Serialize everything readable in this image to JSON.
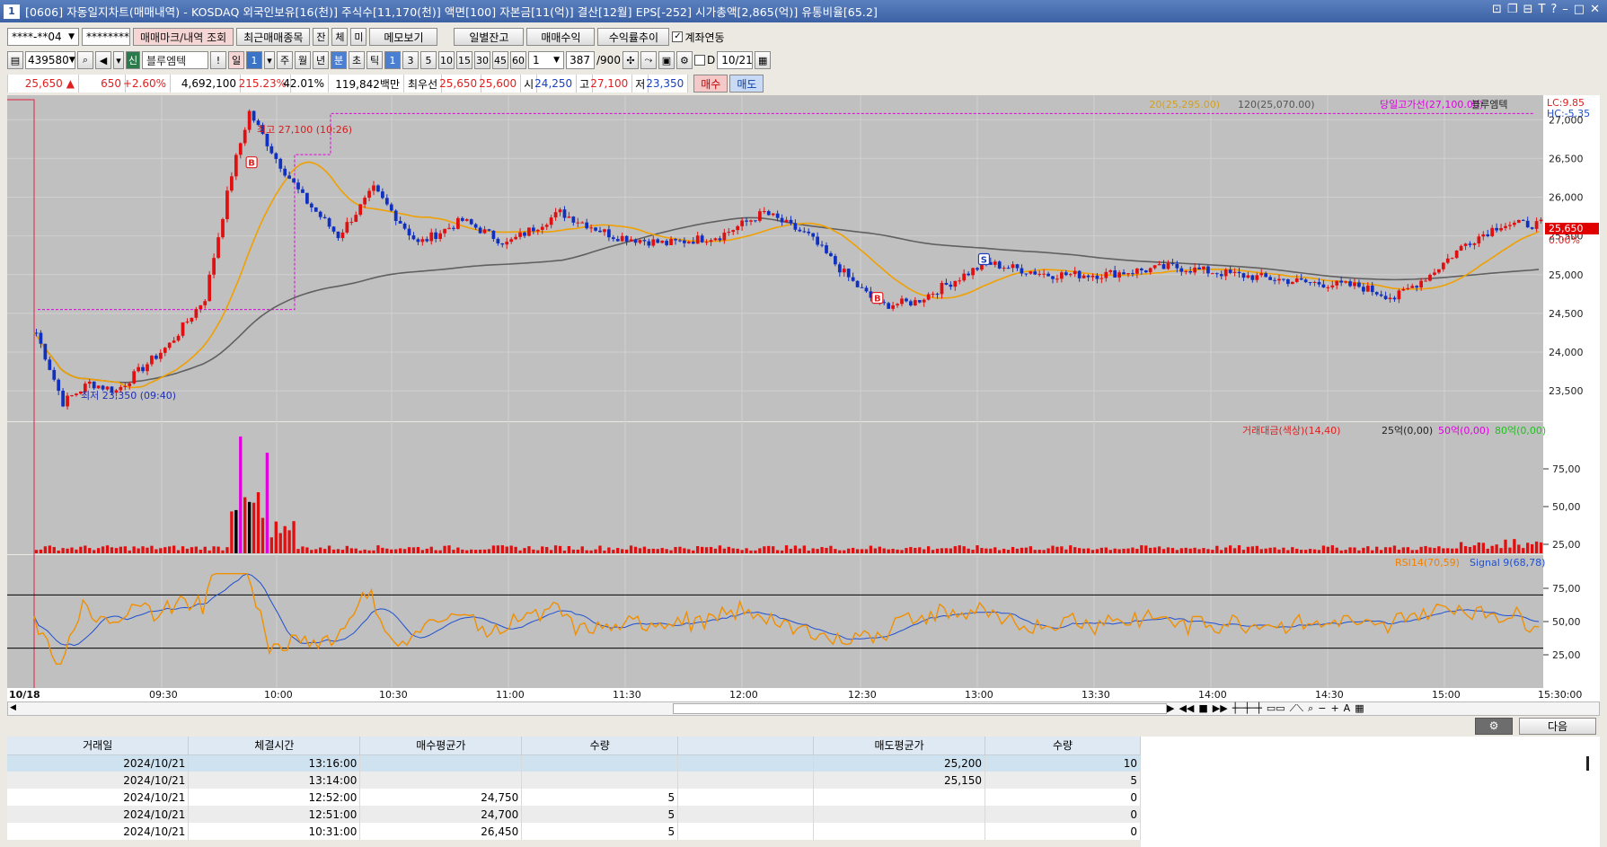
{
  "window": {
    "num": "1",
    "title": "[0606] 자동일지차트(매매내역) - KOSDAQ 외국인보유[16(천)] 주식수[11,170(천)] 액면[100] 자본금[11(억)] 결산[12월] EPS[-252] 시가총액[2,865(억)] 유통비율[65.2]"
  },
  "toolbar1": {
    "account": "****-**04",
    "password": "********",
    "btn_marks": "매매마크/내역 조회",
    "btn_recent": "최근매매종목",
    "tab_jan": "잔",
    "tab_che": "체",
    "tab_mi": "미",
    "btn_memo": "메모보기",
    "btn_daily": "일별잔고",
    "btn_pnl": "매매수익",
    "btn_rate": "수익률추이",
    "chk_link": "계좌연동"
  },
  "toolbar2": {
    "code": "439580",
    "badge": "신",
    "name": "블루엠텍",
    "excl": "!",
    "period_day": "일",
    "period_num": "1",
    "p_week": "주",
    "p_month": "월",
    "p_year": "년",
    "p_min": "분",
    "p_sec": "초",
    "p_tick": "틱",
    "m1": "1",
    "m3": "3",
    "m5": "5",
    "m10": "10",
    "m15": "15",
    "m30": "30",
    "m45": "45",
    "m60": "60",
    "count_sel": "1",
    "count": "387",
    "count_max": "/900",
    "d_label": "D",
    "date": "10/21"
  },
  "quote": {
    "price": "25,650",
    "arrow": "▲",
    "change": "650",
    "pct": "+2.60%",
    "volume": "4,692,100",
    "vol_ratio": "215.23%",
    "turnover": "42.01%",
    "amount": "119,842백만",
    "best_label": "최우선",
    "ask": "25,650",
    "bid": "25,600",
    "open_label": "시",
    "open": "24,250",
    "high_label": "고",
    "high": "27,100",
    "low_label": "저",
    "low": "23,350",
    "buy_btn": "매수",
    "sell_btn": "매도"
  },
  "chart_data": {
    "type": "candlestick",
    "legend": {
      "ma20": "20(25,295.00)",
      "ma120": "120(25,070.00)",
      "day_high": "당일고가선(27,100.00)",
      "name": "블루엠텍",
      "lc": "LC:9.85",
      "hc": "HC:-5.35"
    },
    "high_note": "최고 27,100 (10:26)",
    "low_note": "최저 23,350 (09:40)",
    "price_axis": [
      "27,000",
      "26,500",
      "26,000",
      "25,500",
      "25,000",
      "24,500",
      "24,000",
      "23,500"
    ],
    "current_tag": "25,650",
    "current_pct": "0.00%",
    "volume_legend": {
      "title": "거래대금(색상)(14,40)",
      "a": "25억(0,00)",
      "b": "50억(0,00)",
      "c": "80억(0,00)"
    },
    "volume_axis": [
      "75,00",
      "50,00",
      "25,00"
    ],
    "rsi_legend": {
      "rsi": "RSI14(70,59)",
      "signal": "Signal 9(68,78)"
    },
    "rsi_axis": [
      "75,00",
      "50,00",
      "25,00"
    ],
    "time_labels": [
      "10/18",
      "09:30",
      "10:00",
      "10:30",
      "11:00",
      "11:30",
      "12:00",
      "12:30",
      "13:00",
      "13:30",
      "14:00",
      "14:30",
      "15:00",
      "15:30:00"
    ],
    "ohlc_anchors": [
      [
        0,
        24250
      ],
      [
        6,
        23350
      ],
      [
        12,
        23600
      ],
      [
        18,
        23500
      ],
      [
        24,
        23800
      ],
      [
        30,
        24100
      ],
      [
        38,
        24700
      ],
      [
        44,
        26300
      ],
      [
        48,
        27100
      ],
      [
        54,
        26500
      ],
      [
        60,
        26000
      ],
      [
        68,
        25500
      ],
      [
        76,
        26100
      ],
      [
        86,
        25400
      ],
      [
        96,
        25700
      ],
      [
        106,
        25400
      ],
      [
        118,
        25800
      ],
      [
        130,
        25500
      ],
      [
        142,
        25400
      ],
      [
        154,
        25500
      ],
      [
        164,
        25800
      ],
      [
        174,
        25500
      ],
      [
        184,
        24900
      ],
      [
        190,
        24600
      ],
      [
        198,
        24650
      ],
      [
        206,
        24900
      ],
      [
        214,
        25150
      ],
      [
        228,
        25000
      ],
      [
        240,
        25000
      ],
      [
        256,
        25100
      ],
      [
        270,
        25000
      ],
      [
        286,
        24900
      ],
      [
        298,
        24850
      ],
      [
        306,
        24700
      ],
      [
        314,
        25000
      ],
      [
        322,
        25400
      ],
      [
        330,
        25650
      ]
    ],
    "marks": [
      {
        "type": "B",
        "bar": 49,
        "price": 26450
      },
      {
        "type": "S",
        "bar": 214,
        "price": 25200
      },
      {
        "type": "B",
        "bar": 190,
        "price": 24700
      }
    ]
  },
  "bottom": {
    "next_btn": "다음"
  },
  "table": {
    "headers": [
      "거래일",
      "체결시간",
      "매수평균가",
      "수량",
      "",
      "매도평균가",
      "수량"
    ],
    "rows": [
      [
        "2024/10/21",
        "13:16:00",
        "",
        "",
        "",
        "25,200",
        "10"
      ],
      [
        "2024/10/21",
        "13:14:00",
        "",
        "",
        "",
        "25,150",
        "5"
      ],
      [
        "2024/10/21",
        "12:52:00",
        "24,750",
        "5",
        "",
        "",
        "0"
      ],
      [
        "2024/10/21",
        "12:51:00",
        "24,700",
        "5",
        "",
        "",
        "0"
      ],
      [
        "2024/10/21",
        "10:31:00",
        "26,450",
        "5",
        "",
        "",
        "0"
      ]
    ]
  }
}
